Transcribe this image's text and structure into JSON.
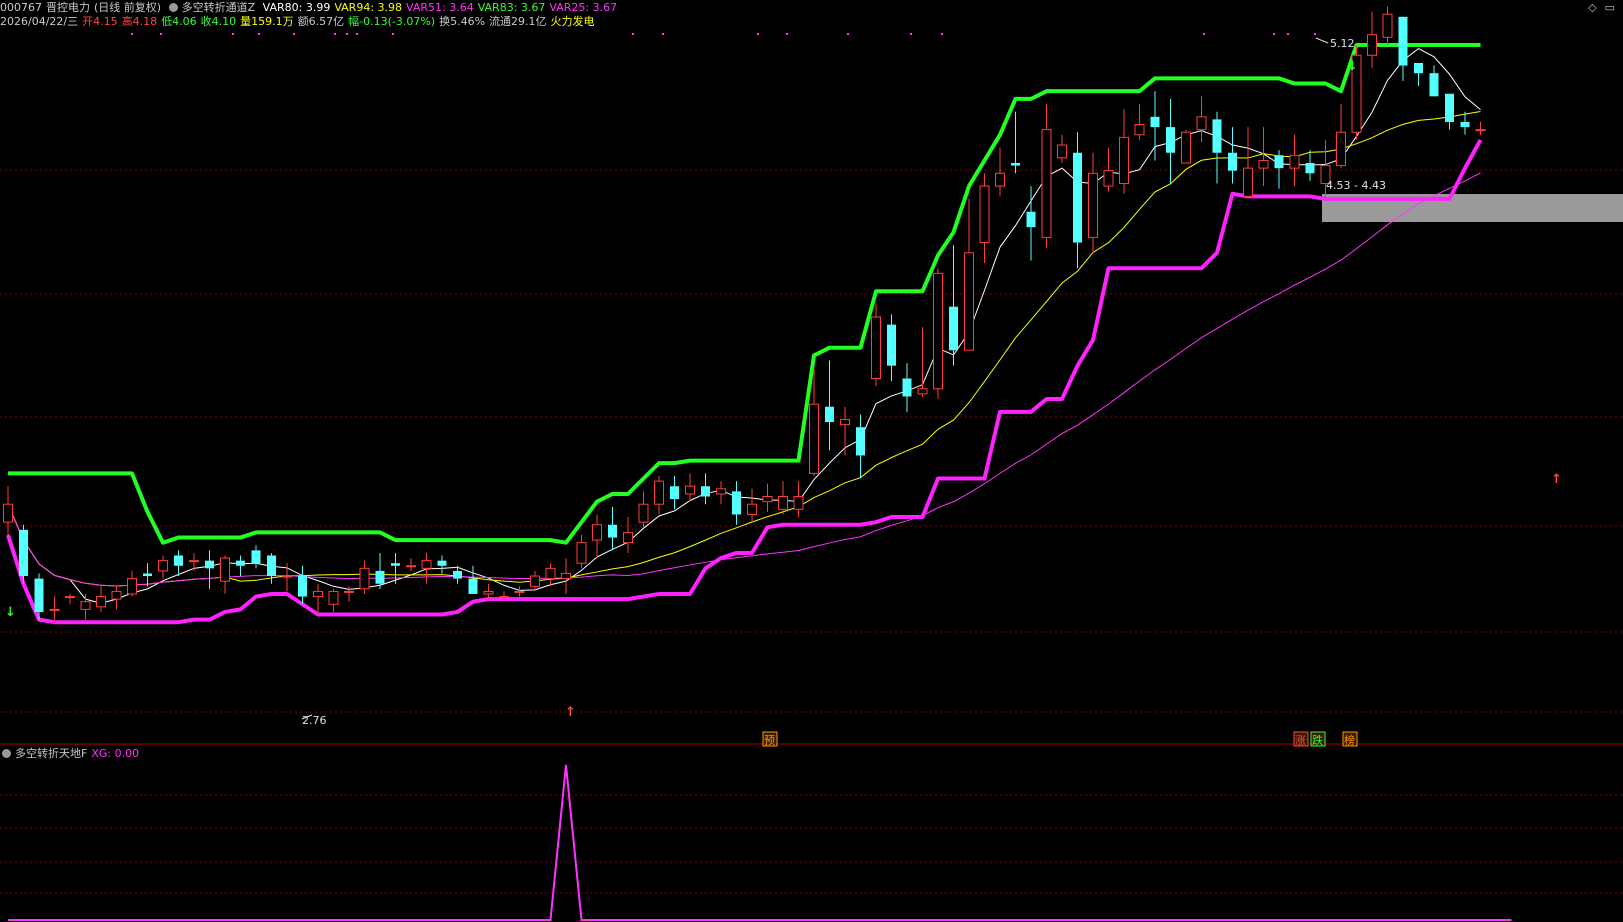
{
  "header": {
    "code": "000767",
    "name": "晋控电力",
    "period": "(日线 前复权)",
    "indicator": "多空转折通道Z",
    "vars": [
      {
        "label": "VAR80: 3.99",
        "color": "#ffffff"
      },
      {
        "label": "VAR94: 3.98",
        "color": "#ffff00"
      },
      {
        "label": "VAR51: 3.64",
        "color": "#ff33ff"
      },
      {
        "label": "VAR83: 3.67",
        "color": "#33ff33"
      },
      {
        "label": "VAR25: 3.67",
        "color": "#ff33ff"
      }
    ],
    "quote": [
      {
        "text": "2026/04/22/三",
        "color": "#c8c8c8"
      },
      {
        "text": "开4.15",
        "color": "#ff4444"
      },
      {
        "text": "高4.18",
        "color": "#ff4444"
      },
      {
        "text": "低4.06",
        "color": "#33ff33"
      },
      {
        "text": "收4.10",
        "color": "#33ff33"
      },
      {
        "text": "量159.1万",
        "color": "#ffff00"
      },
      {
        "text": "额6.57亿",
        "color": "#c8c8c8"
      },
      {
        "text": "幅-0.13(-3.07%)",
        "color": "#33ff33"
      },
      {
        "text": "换5.46%",
        "color": "#c8c8c8"
      },
      {
        "text": "流通29.1亿",
        "color": "#c8c8c8"
      },
      {
        "text": "火力发电",
        "color": "#ffff00"
      }
    ]
  },
  "corner_icons": [
    "diamond-icon",
    "window-icon"
  ],
  "sub_header": {
    "indicator": "多空转折天地F",
    "xg_label": "XG: 0.00",
    "xg_color": "#ff33ff"
  },
  "colors": {
    "up": "#ff3c3c",
    "down": "#54ffff",
    "ma_short": "#ffffff",
    "ma_mid": "#ffff00",
    "ma_long": "#ff33ff",
    "upper_channel": "#22ff22",
    "lower_channel": "#ff22ff",
    "grid": "#8b0000",
    "resistance_zone": "#9a9a9a"
  },
  "chart_data": {
    "type": "candlestick",
    "price_range": [
      2.6,
      5.2
    ],
    "candles": [
      [
        3.34,
        3.41,
        3.48,
        3.29
      ],
      [
        3.31,
        3.13,
        3.33,
        3.1
      ],
      [
        3.12,
        2.99,
        3.14,
        2.96
      ],
      [
        3,
        3,
        3.05,
        2.95
      ],
      [
        3.05,
        3.05,
        3.06,
        3.02
      ],
      [
        3,
        3.03,
        3.06,
        2.96
      ],
      [
        3.01,
        3.05,
        3.09,
        2.99
      ],
      [
        3.04,
        3.07,
        3.09,
        3
      ],
      [
        3.06,
        3.12,
        3.15,
        3.05
      ],
      [
        3.14,
        3.13,
        3.18,
        3.09
      ],
      [
        3.15,
        3.19,
        3.21,
        3.12
      ],
      [
        3.21,
        3.17,
        3.23,
        3.13
      ],
      [
        3.19,
        3.19,
        3.22,
        3.15
      ],
      [
        3.19,
        3.16,
        3.23,
        3.08
      ],
      [
        3.11,
        3.2,
        3.21,
        3.06
      ],
      [
        3.19,
        3.17,
        3.21,
        3.13
      ],
      [
        3.23,
        3.18,
        3.25,
        3.16
      ],
      [
        3.21,
        3.13,
        3.22,
        3.1
      ],
      [
        3.13,
        3.13,
        3.18,
        3.07
      ],
      [
        3.13,
        3.05,
        3.17,
        3.02
      ],
      [
        3.05,
        3.07,
        3.1,
        2.98
      ],
      [
        3.02,
        3.07,
        3.08,
        2.99
      ],
      [
        3.07,
        3.07,
        3.09,
        3.03
      ],
      [
        3.08,
        3.16,
        3.19,
        3.06
      ],
      [
        3.15,
        3.1,
        3.22,
        3.08
      ],
      [
        3.18,
        3.17,
        3.22,
        3.1
      ],
      [
        3.17,
        3.17,
        3.2,
        3.15
      ],
      [
        3.16,
        3.19,
        3.22,
        3.1
      ],
      [
        3.19,
        3.17,
        3.21,
        3.14
      ],
      [
        3.15,
        3.12,
        3.17,
        3.1
      ],
      [
        3.12,
        3.06,
        3.17,
        3.06
      ],
      [
        3.06,
        3.07,
        3.1,
        3.04
      ],
      [
        3.05,
        3.05,
        3.07,
        3.04
      ],
      [
        3.07,
        3.07,
        3.09,
        3.05
      ],
      [
        3.09,
        3.13,
        3.15,
        3.07
      ],
      [
        3.12,
        3.16,
        3.18,
        3.09
      ],
      [
        3.12,
        3.14,
        3.2,
        3.06
      ],
      [
        3.18,
        3.26,
        3.29,
        3.16
      ],
      [
        3.27,
        3.33,
        3.37,
        3.2
      ],
      [
        3.33,
        3.28,
        3.4,
        3.23
      ],
      [
        3.26,
        3.3,
        3.36,
        3.22
      ],
      [
        3.34,
        3.41,
        3.46,
        3.32
      ],
      [
        3.41,
        3.5,
        3.52,
        3.37
      ],
      [
        3.48,
        3.43,
        3.52,
        3.39
      ],
      [
        3.45,
        3.48,
        3.53,
        3.42
      ],
      [
        3.48,
        3.44,
        3.53,
        3.41
      ],
      [
        3.45,
        3.47,
        3.5,
        3.41
      ],
      [
        3.46,
        3.37,
        3.5,
        3.33
      ],
      [
        3.37,
        3.41,
        3.47,
        3.34
      ],
      [
        3.42,
        3.44,
        3.49,
        3.38
      ],
      [
        3.39,
        3.44,
        3.5,
        3.37
      ],
      [
        3.39,
        3.44,
        3.5,
        3.36
      ],
      [
        3.53,
        3.8,
        3.94,
        3.52
      ],
      [
        3.79,
        3.73,
        3.97,
        3.62
      ],
      [
        3.72,
        3.74,
        3.79,
        3.6
      ],
      [
        3.71,
        3.6,
        3.76,
        3.51
      ],
      [
        3.9,
        4.14,
        4.19,
        3.87
      ],
      [
        4.11,
        3.95,
        4.15,
        3.89
      ],
      [
        3.9,
        3.83,
        3.96,
        3.77
      ],
      [
        3.84,
        3.86,
        4.1,
        3.83
      ],
      [
        3.86,
        4.31,
        4.33,
        3.82
      ],
      [
        4.18,
        4.01,
        4.42,
        3.95
      ],
      [
        4.01,
        4.39,
        4.6,
        4.05
      ],
      [
        4.43,
        4.65,
        4.7,
        4.35
      ],
      [
        4.65,
        4.7,
        4.8,
        4.61
      ],
      [
        4.74,
        4.73,
        4.94,
        4.7
      ],
      [
        4.55,
        4.49,
        4.65,
        4.36
      ],
      [
        4.45,
        4.87,
        4.97,
        4.41
      ],
      [
        4.76,
        4.81,
        4.85,
        4.74
      ],
      [
        4.78,
        4.43,
        4.86,
        4.33
      ],
      [
        4.45,
        4.7,
        4.78,
        4.39
      ],
      [
        4.65,
        4.71,
        4.8,
        4.63
      ],
      [
        4.66,
        4.84,
        4.95,
        4.62
      ],
      [
        4.85,
        4.89,
        4.97,
        4.83
      ],
      [
        4.92,
        4.88,
        5.02,
        4.75
      ],
      [
        4.88,
        4.78,
        4.99,
        4.66
      ],
      [
        4.74,
        4.86,
        4.87,
        4.8
      ],
      [
        4.87,
        4.92,
        5.0,
        4.82
      ],
      [
        4.91,
        4.78,
        4.94,
        4.66
      ],
      [
        4.78,
        4.71,
        4.88,
        4.66
      ],
      [
        4.61,
        4.72,
        4.88,
        4.61
      ],
      [
        4.72,
        4.75,
        4.88,
        4.65
      ],
      [
        4.77,
        4.72,
        4.79,
        4.64
      ],
      [
        4.72,
        4.77,
        4.85,
        4.65
      ],
      [
        4.74,
        4.7,
        4.79,
        4.67
      ],
      [
        4.66,
        4.73,
        4.83,
        4.6
      ],
      [
        4.73,
        4.86,
        4.97,
        4.72
      ],
      [
        4.86,
        5.16,
        5.2,
        4.83
      ],
      [
        5.16,
        5.24,
        5.33,
        5.11
      ],
      [
        5.23,
        5.32,
        5.35,
        5.2
      ],
      [
        5.31,
        5.12,
        5.29,
        5.06
      ],
      [
        5.13,
        5.09,
        5.13,
        5.04
      ],
      [
        5.09,
        5.0,
        5.12,
        5.0
      ],
      [
        5.01,
        4.9,
        5.0,
        4.87
      ],
      [
        4.9,
        4.88,
        4.94,
        4.85
      ],
      [
        4.87,
        4.87,
        4.9,
        4.85
      ]
    ]
  },
  "annotations": {
    "max_label": "5.12",
    "min_label": "2.76",
    "zone_label": "4.53 - 4.43",
    "markers": [
      "预",
      "涨",
      "跌",
      "榜"
    ]
  },
  "sub_chart": {
    "xg_range": [
      0,
      1
    ],
    "xg_spike_indices": [
      36,
      98
    ]
  }
}
